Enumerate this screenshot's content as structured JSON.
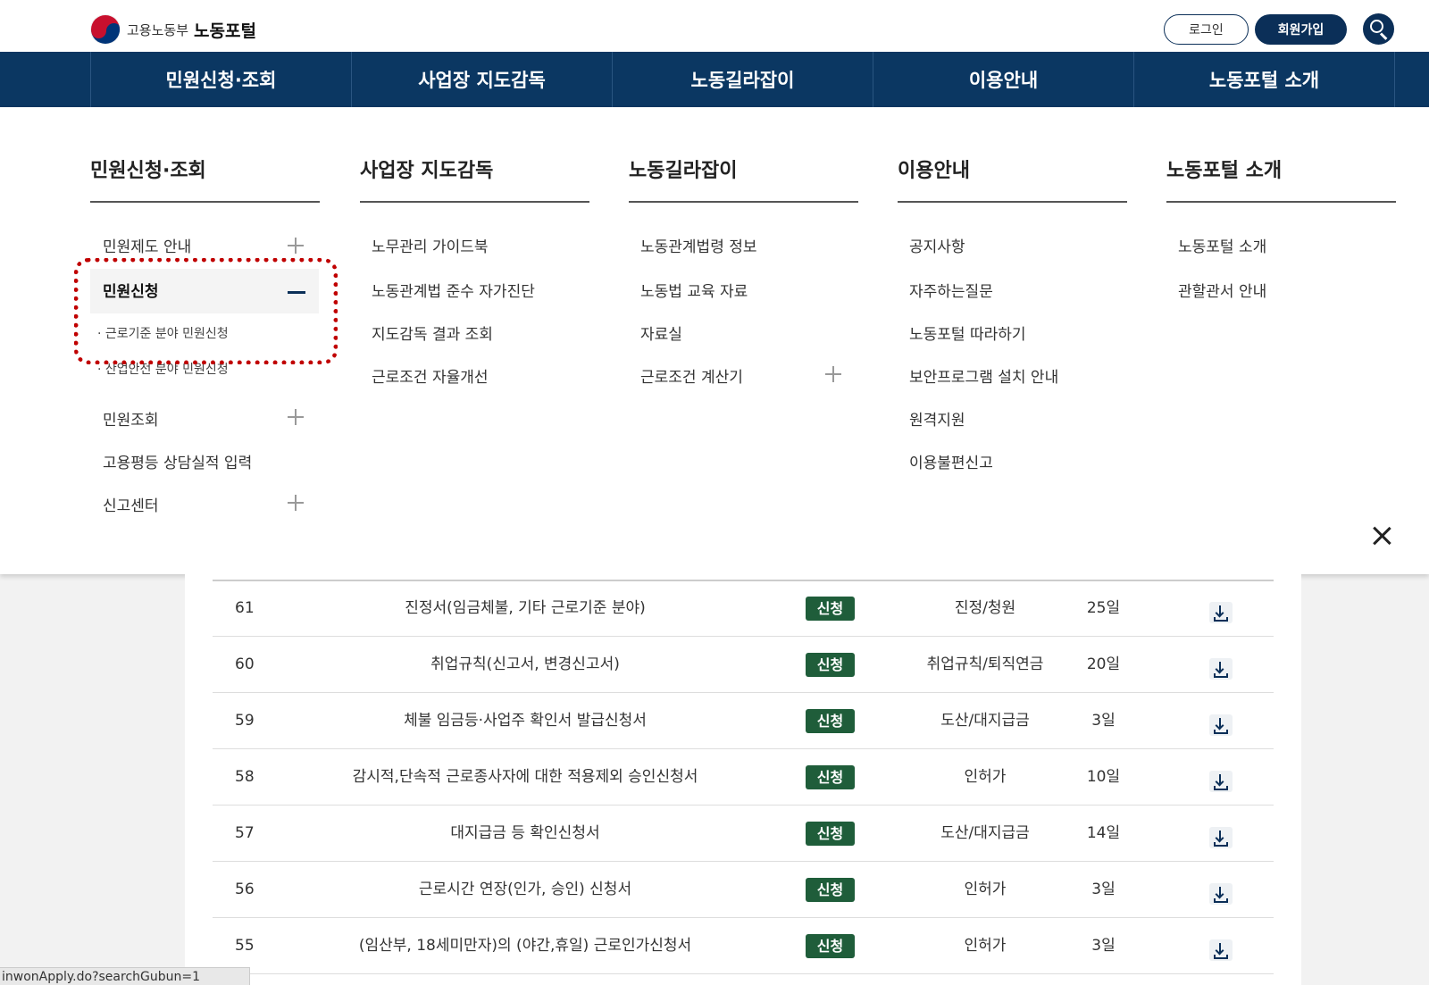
{
  "header": {
    "logo_org": "고용노동부",
    "logo_site": "노동포털",
    "login_label": "로그인",
    "join_label": "회원가입",
    "search_icon": "search-icon"
  },
  "nav": {
    "items": [
      "민원신청·조회",
      "사업장 지도감독",
      "노동길라잡이",
      "이용안내",
      "노동포털 소개"
    ]
  },
  "mega": {
    "columns": [
      {
        "title": "민원신청·조회",
        "items": [
          "민원제도 안내",
          "민원신청",
          "민원조회",
          "고용평등 상담실적 입력",
          "신고센터"
        ],
        "subitems": [
          "근로기준 분야 민원신청",
          "산업안전 분야 민원신청"
        ]
      },
      {
        "title": "사업장 지도감독",
        "items": [
          "노무관리 가이드북",
          "노동관계법 준수 자가진단",
          "지도감독 결과 조회",
          "근로조건 자율개선"
        ]
      },
      {
        "title": "노동길라잡이",
        "items": [
          "노동관계법령 정보",
          "노동법 교육 자료",
          "자료실",
          "근로조건 계산기"
        ]
      },
      {
        "title": "이용안내",
        "items": [
          "공지사항",
          "자주하는질문",
          "노동포털 따라하기",
          "보안프로그램 설치 안내",
          "원격지원",
          "이용불편신고"
        ]
      },
      {
        "title": "노동포털 소개",
        "items": [
          "노동포털 소개",
          "관할관서 안내"
        ]
      }
    ],
    "close_icon": "close-icon"
  },
  "table": {
    "badge": "신청",
    "rows": [
      {
        "no": "61",
        "name": "진정서(임금체불, 기타 근로기준 분야)",
        "category": "진정/청원",
        "days": "25일"
      },
      {
        "no": "60",
        "name": "취업규칙(신고서, 변경신고서)",
        "category": "취업규칙/퇴직연금",
        "days": "20일"
      },
      {
        "no": "59",
        "name": "체불 임금등·사업주 확인서 발급신청서",
        "category": "도산/대지급금",
        "days": "3일"
      },
      {
        "no": "58",
        "name": "감시적,단속적 근로종사자에 대한 적용제외 승인신청서",
        "category": "인허가",
        "days": "10일"
      },
      {
        "no": "57",
        "name": "대지급금 등 확인신청서",
        "category": "도산/대지급금",
        "days": "14일"
      },
      {
        "no": "56",
        "name": "근로시간 연장(인가, 승인) 신청서",
        "category": "인허가",
        "days": "3일"
      },
      {
        "no": "55",
        "name": "(임산부, 18세미만자)의 (야간,휴일) 근로인가신청서",
        "category": "인허가",
        "days": "3일"
      }
    ]
  },
  "statusbar": {
    "url": "inwonApply.do?searchGubun=1"
  }
}
